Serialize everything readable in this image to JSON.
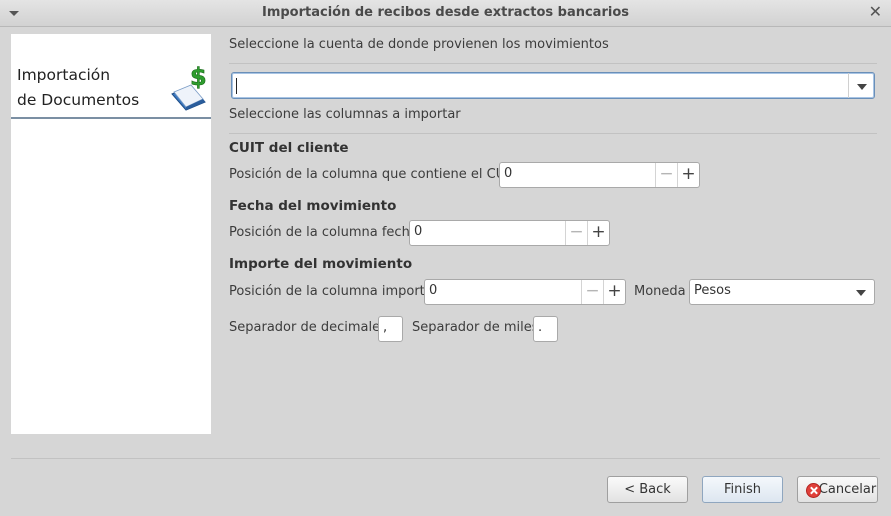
{
  "window": {
    "title": "Importación de recibos desde extractos bancarios",
    "close_glyph": "✕"
  },
  "sidebar": {
    "heading_line1": "Importación",
    "heading_line2": "de Documentos",
    "icon": "book-dollar-icon"
  },
  "account": {
    "label": "Seleccione la cuenta de donde provienen los movimientos",
    "value": ""
  },
  "columns_label": "Seleccione las columnas a importar",
  "cuit": {
    "section": "CUIT del cliente",
    "label": "Posición de la columna que contiene el CUIT",
    "value": "0"
  },
  "fecha": {
    "section": "Fecha del movimiento",
    "label": "Posición de la columna fecha",
    "value": "0"
  },
  "importe": {
    "section": "Importe del movimiento",
    "label": "Posición de la columna importe",
    "value": "0",
    "moneda_label": "Moneda",
    "moneda_value": "Pesos"
  },
  "separators": {
    "decimal_label": "Separador de decimales",
    "decimal_value": ",",
    "thousands_label": "Separador de miles",
    "thousands_value": "."
  },
  "spin_glyphs": {
    "minus": "−",
    "plus": "+"
  },
  "buttons": {
    "back": "< Back",
    "finish": "Finish",
    "cancel": "Cancelar"
  },
  "colors": {
    "accent": "#7b8fa3",
    "cancel_red": "#e0403a",
    "dollar_green": "#2e9d2e"
  }
}
